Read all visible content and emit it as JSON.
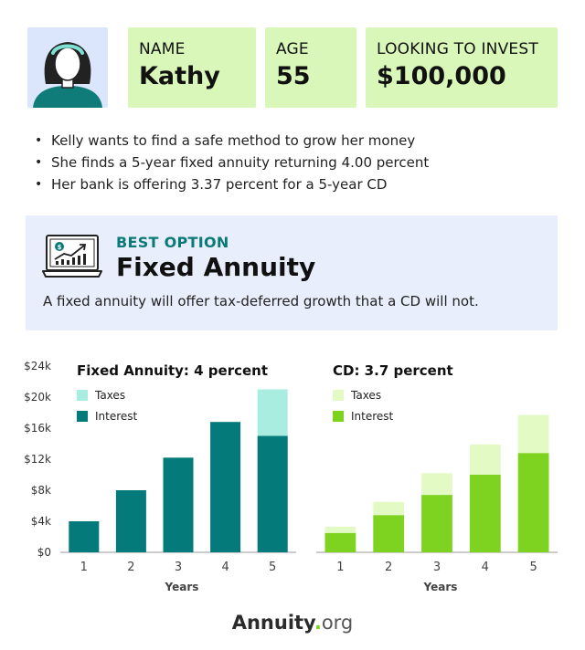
{
  "profile": {
    "name_label": "NAME",
    "name_value": "Kathy",
    "age_label": "AGE",
    "age_value": "55",
    "invest_label": "LOOKING TO INVEST",
    "invest_value": "$100,000"
  },
  "bullets": [
    "Kelly wants to find a safe method to grow her money",
    "She finds a 5-year fixed annuity returning 4.00 percent",
    "Her bank is offering 3.37 percent for a 5-year CD"
  ],
  "best_option": {
    "tag": "BEST OPTION",
    "title": "Fixed Annuity",
    "description": "A fixed annuity will offer tax-deferred growth that a CD will not."
  },
  "colors": {
    "teal_dark": "#047a7b",
    "teal_light": "#a9ede0",
    "green_dark": "#7ed321",
    "green_light": "#e3fac5",
    "panel_bg": "#e8eefb",
    "card_bg": "#d9f7b9"
  },
  "chart_data": [
    {
      "type": "bar",
      "title": "Fixed Annuity: 4 percent",
      "xlabel": "Years",
      "ylabel": "",
      "categories": [
        "1",
        "2",
        "3",
        "4",
        "5"
      ],
      "ylim": [
        0,
        24000
      ],
      "yticks": [
        "$0",
        "$4k",
        "$8k",
        "$12k",
        "$16k",
        "$20k",
        "$24k"
      ],
      "stacked": true,
      "series": [
        {
          "name": "Interest",
          "color": "#047a7b",
          "values": [
            4000,
            8000,
            12200,
            16800,
            15000
          ]
        },
        {
          "name": "Taxes",
          "color": "#a9ede0",
          "values": [
            0,
            0,
            0,
            0,
            6000
          ]
        }
      ],
      "legend": [
        "Taxes",
        "Interest"
      ]
    },
    {
      "type": "bar",
      "title": "CD: 3.7 percent",
      "xlabel": "Years",
      "ylabel": "",
      "categories": [
        "1",
        "2",
        "3",
        "4",
        "5"
      ],
      "ylim": [
        0,
        24000
      ],
      "stacked": true,
      "series": [
        {
          "name": "Interest",
          "color": "#7ed321",
          "values": [
            2500,
            4800,
            7400,
            10000,
            12800
          ]
        },
        {
          "name": "Taxes",
          "color": "#e3fac5",
          "values": [
            800,
            1700,
            2800,
            3900,
            4900
          ]
        }
      ],
      "legend": [
        "Taxes",
        "Interest"
      ]
    }
  ],
  "footer": {
    "brand": "Annuity",
    "dot": ".",
    "suffix": "org"
  }
}
